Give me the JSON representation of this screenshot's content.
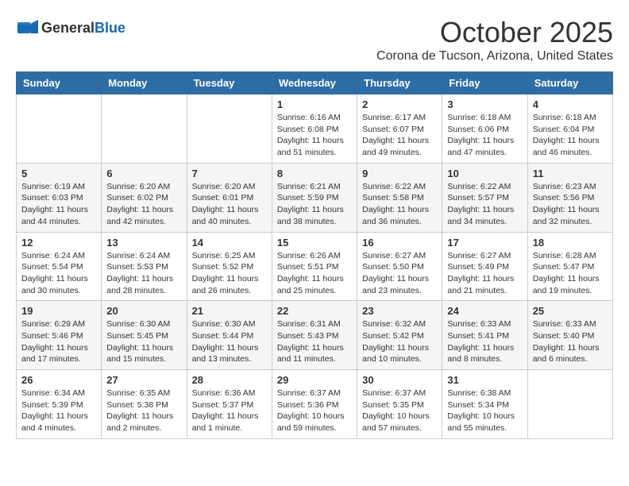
{
  "logo": {
    "general": "General",
    "blue": "Blue"
  },
  "header": {
    "month": "October 2025",
    "location": "Corona de Tucson, Arizona, United States"
  },
  "weekdays": [
    "Sunday",
    "Monday",
    "Tuesday",
    "Wednesday",
    "Thursday",
    "Friday",
    "Saturday"
  ],
  "weeks": [
    [
      {
        "day": "",
        "info": ""
      },
      {
        "day": "",
        "info": ""
      },
      {
        "day": "",
        "info": ""
      },
      {
        "day": "1",
        "info": "Sunrise: 6:16 AM\nSunset: 6:08 PM\nDaylight: 11 hours\nand 51 minutes."
      },
      {
        "day": "2",
        "info": "Sunrise: 6:17 AM\nSunset: 6:07 PM\nDaylight: 11 hours\nand 49 minutes."
      },
      {
        "day": "3",
        "info": "Sunrise: 6:18 AM\nSunset: 6:06 PM\nDaylight: 11 hours\nand 47 minutes."
      },
      {
        "day": "4",
        "info": "Sunrise: 6:18 AM\nSunset: 6:04 PM\nDaylight: 11 hours\nand 46 minutes."
      }
    ],
    [
      {
        "day": "5",
        "info": "Sunrise: 6:19 AM\nSunset: 6:03 PM\nDaylight: 11 hours\nand 44 minutes."
      },
      {
        "day": "6",
        "info": "Sunrise: 6:20 AM\nSunset: 6:02 PM\nDaylight: 11 hours\nand 42 minutes."
      },
      {
        "day": "7",
        "info": "Sunrise: 6:20 AM\nSunset: 6:01 PM\nDaylight: 11 hours\nand 40 minutes."
      },
      {
        "day": "8",
        "info": "Sunrise: 6:21 AM\nSunset: 5:59 PM\nDaylight: 11 hours\nand 38 minutes."
      },
      {
        "day": "9",
        "info": "Sunrise: 6:22 AM\nSunset: 5:58 PM\nDaylight: 11 hours\nand 36 minutes."
      },
      {
        "day": "10",
        "info": "Sunrise: 6:22 AM\nSunset: 5:57 PM\nDaylight: 11 hours\nand 34 minutes."
      },
      {
        "day": "11",
        "info": "Sunrise: 6:23 AM\nSunset: 5:56 PM\nDaylight: 11 hours\nand 32 minutes."
      }
    ],
    [
      {
        "day": "12",
        "info": "Sunrise: 6:24 AM\nSunset: 5:54 PM\nDaylight: 11 hours\nand 30 minutes."
      },
      {
        "day": "13",
        "info": "Sunrise: 6:24 AM\nSunset: 5:53 PM\nDaylight: 11 hours\nand 28 minutes."
      },
      {
        "day": "14",
        "info": "Sunrise: 6:25 AM\nSunset: 5:52 PM\nDaylight: 11 hours\nand 26 minutes."
      },
      {
        "day": "15",
        "info": "Sunrise: 6:26 AM\nSunset: 5:51 PM\nDaylight: 11 hours\nand 25 minutes."
      },
      {
        "day": "16",
        "info": "Sunrise: 6:27 AM\nSunset: 5:50 PM\nDaylight: 11 hours\nand 23 minutes."
      },
      {
        "day": "17",
        "info": "Sunrise: 6:27 AM\nSunset: 5:49 PM\nDaylight: 11 hours\nand 21 minutes."
      },
      {
        "day": "18",
        "info": "Sunrise: 6:28 AM\nSunset: 5:47 PM\nDaylight: 11 hours\nand 19 minutes."
      }
    ],
    [
      {
        "day": "19",
        "info": "Sunrise: 6:29 AM\nSunset: 5:46 PM\nDaylight: 11 hours\nand 17 minutes."
      },
      {
        "day": "20",
        "info": "Sunrise: 6:30 AM\nSunset: 5:45 PM\nDaylight: 11 hours\nand 15 minutes."
      },
      {
        "day": "21",
        "info": "Sunrise: 6:30 AM\nSunset: 5:44 PM\nDaylight: 11 hours\nand 13 minutes."
      },
      {
        "day": "22",
        "info": "Sunrise: 6:31 AM\nSunset: 5:43 PM\nDaylight: 11 hours\nand 11 minutes."
      },
      {
        "day": "23",
        "info": "Sunrise: 6:32 AM\nSunset: 5:42 PM\nDaylight: 11 hours\nand 10 minutes."
      },
      {
        "day": "24",
        "info": "Sunrise: 6:33 AM\nSunset: 5:41 PM\nDaylight: 11 hours\nand 8 minutes."
      },
      {
        "day": "25",
        "info": "Sunrise: 6:33 AM\nSunset: 5:40 PM\nDaylight: 11 hours\nand 6 minutes."
      }
    ],
    [
      {
        "day": "26",
        "info": "Sunrise: 6:34 AM\nSunset: 5:39 PM\nDaylight: 11 hours\nand 4 minutes."
      },
      {
        "day": "27",
        "info": "Sunrise: 6:35 AM\nSunset: 5:38 PM\nDaylight: 11 hours\nand 2 minutes."
      },
      {
        "day": "28",
        "info": "Sunrise: 6:36 AM\nSunset: 5:37 PM\nDaylight: 11 hours\nand 1 minute."
      },
      {
        "day": "29",
        "info": "Sunrise: 6:37 AM\nSunset: 5:36 PM\nDaylight: 10 hours\nand 59 minutes."
      },
      {
        "day": "30",
        "info": "Sunrise: 6:37 AM\nSunset: 5:35 PM\nDaylight: 10 hours\nand 57 minutes."
      },
      {
        "day": "31",
        "info": "Sunrise: 6:38 AM\nSunset: 5:34 PM\nDaylight: 10 hours\nand 55 minutes."
      },
      {
        "day": "",
        "info": ""
      }
    ]
  ]
}
